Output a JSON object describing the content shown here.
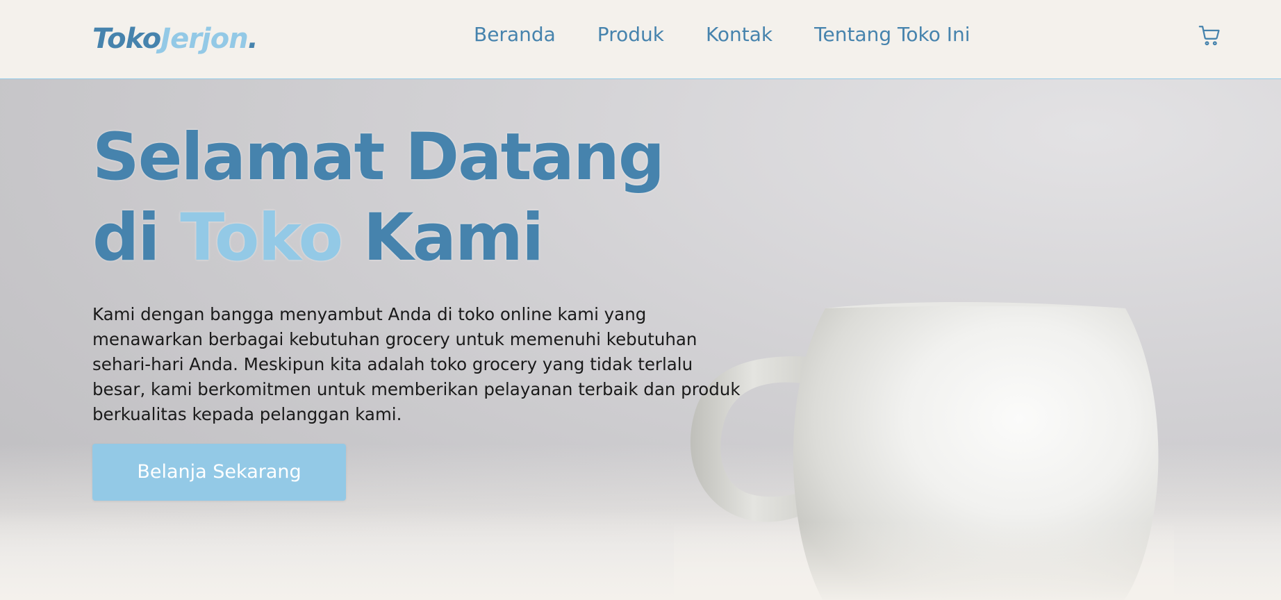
{
  "brand": {
    "part1": "Toko",
    "part2": "Jerjon",
    "part3": "."
  },
  "nav": {
    "items": [
      {
        "label": "Beranda"
      },
      {
        "label": "Produk"
      },
      {
        "label": "Kontak"
      },
      {
        "label": "Tentang Toko Ini"
      }
    ],
    "cart_icon": "shopping-cart-icon"
  },
  "hero": {
    "title_line1": "Selamat Datang",
    "title_line2_a": "di",
    "title_line2_accent": "Toko",
    "title_line2_b": "Kami",
    "description": "Kami dengan bangga menyambut Anda di toko online kami yang menawarkan berbagai kebutuhan grocery untuk memenuhi kebutuhan sehari-hari Anda. Meskipun kita adalah toko grocery yang tidak terlalu besar, kami berkomitmen untuk memberikan pelayanan terbaik dan produk berkualitas kepada pelanggan kami.",
    "cta_label": "Belanja Sekarang"
  },
  "colors": {
    "primary": "#4683ad",
    "accent": "#93c9e6",
    "background": "#f4f1ec",
    "text": "#1a1a1a"
  }
}
